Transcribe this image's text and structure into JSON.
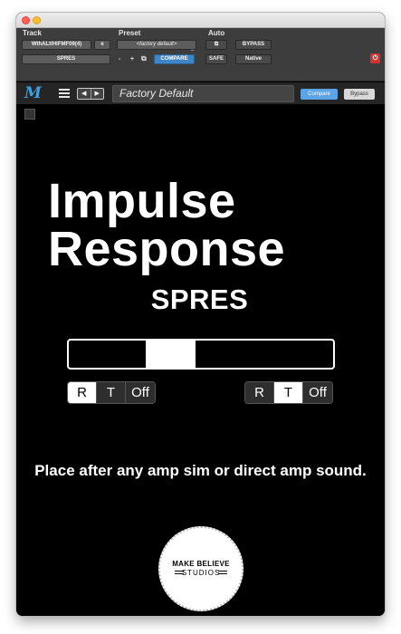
{
  "protools": {
    "track_label": "Track",
    "preset_label": "Preset",
    "auto_label": "Auto",
    "track_name": "WthALtIHIFMF09(4)",
    "track_sel": "e",
    "insert_name": "SPRES",
    "preset_name": "<factory default>",
    "minus": "-",
    "plus": "+",
    "compare": "COMPARE",
    "bypass": "BYPASS",
    "safe": "SAFE",
    "native": "Native"
  },
  "pluginbar": {
    "preset_name": "Factory Default",
    "compare": "Compare",
    "bypass": "Bypass"
  },
  "plugin": {
    "title_line1": "Impulse",
    "title_line2": "Response",
    "subtitle": "SPRES",
    "slider_value": 0.36,
    "left_group": [
      {
        "label": "R",
        "active": true
      },
      {
        "label": "T",
        "active": false
      },
      {
        "label": "Off",
        "active": false
      }
    ],
    "right_group": [
      {
        "label": "R",
        "active": false
      },
      {
        "label": "T",
        "active": true
      },
      {
        "label": "Off",
        "active": false
      }
    ],
    "note": "Place after any amp sim or direct amp sound.",
    "badge_line1": "MAKE BELIEVE",
    "badge_line2": "STUDIOS"
  }
}
